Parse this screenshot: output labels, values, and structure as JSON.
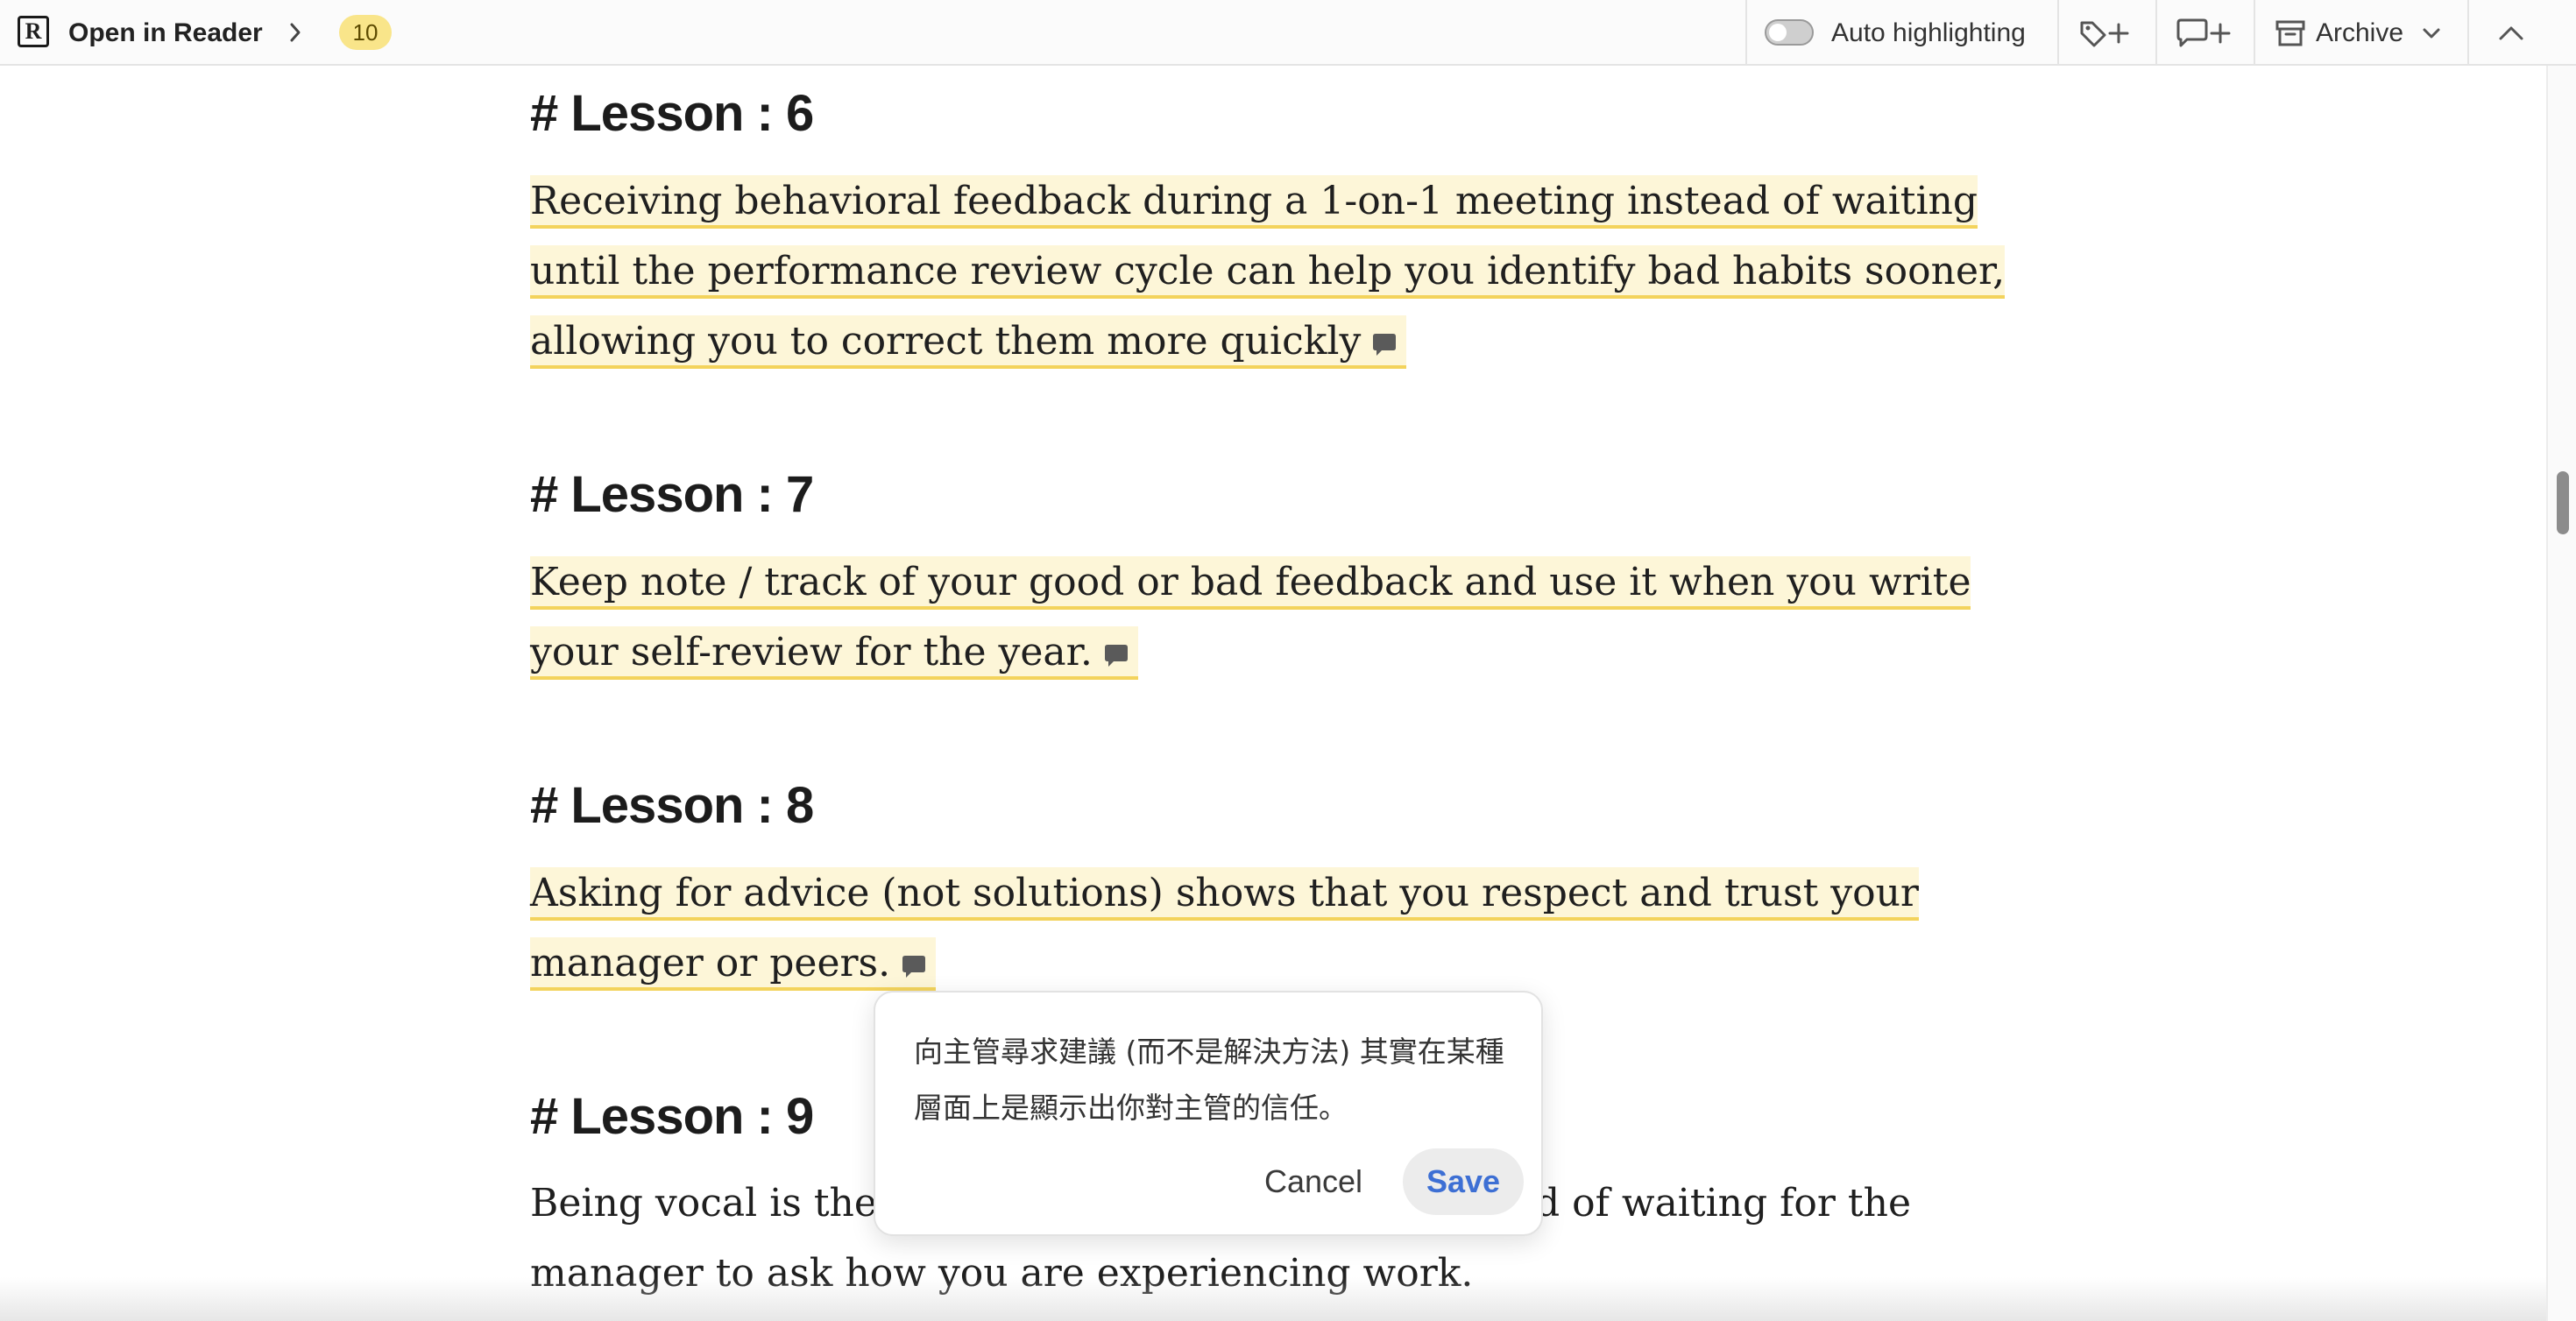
{
  "toolbar": {
    "logo_letter": "R",
    "open_in_reader": "Open in Reader",
    "highlight_count": "10",
    "auto_highlighting": "Auto highlighting",
    "archive": "Archive",
    "icons": [
      "chevron-right-icon",
      "tag-plus-icon",
      "comment-plus-icon",
      "archive-icon",
      "chevron-down-icon",
      "chevron-up-icon"
    ]
  },
  "content": {
    "lesson6": {
      "heading": "# Lesson : 6",
      "highlight": "Receiving behavioral feedback during a 1-on-1 meeting instead of waiting until the performance review cycle can help you identify bad habits sooner, allowing you to correct them more quickly"
    },
    "lesson7": {
      "heading": "# Lesson : 7",
      "highlight": "Keep note / track of your good or bad feedback and use it when you write your self-review for the year."
    },
    "lesson8": {
      "heading": "# Lesson : 8",
      "highlight": "Asking for advice (not solutions) shows that you respect and trust your manager or peers."
    },
    "lesson9": {
      "heading": "# Lesson : 9",
      "text_start": "Being vocal is the",
      "text_end": "d of waiting for the",
      "text_line2": "manager to ask how you are experiencing work."
    }
  },
  "note_popup": {
    "text": "向主管尋求建議 (而不是解決方法) 其實在某種層面上是顯示出你對主管的信任。",
    "cancel": "Cancel",
    "save": "Save"
  },
  "colors": {
    "highlight_bg": "#fdf6d8",
    "highlight_underline": "#f3d35c",
    "badge_bg": "#f9e58a",
    "save_text": "#3d6fd4"
  }
}
